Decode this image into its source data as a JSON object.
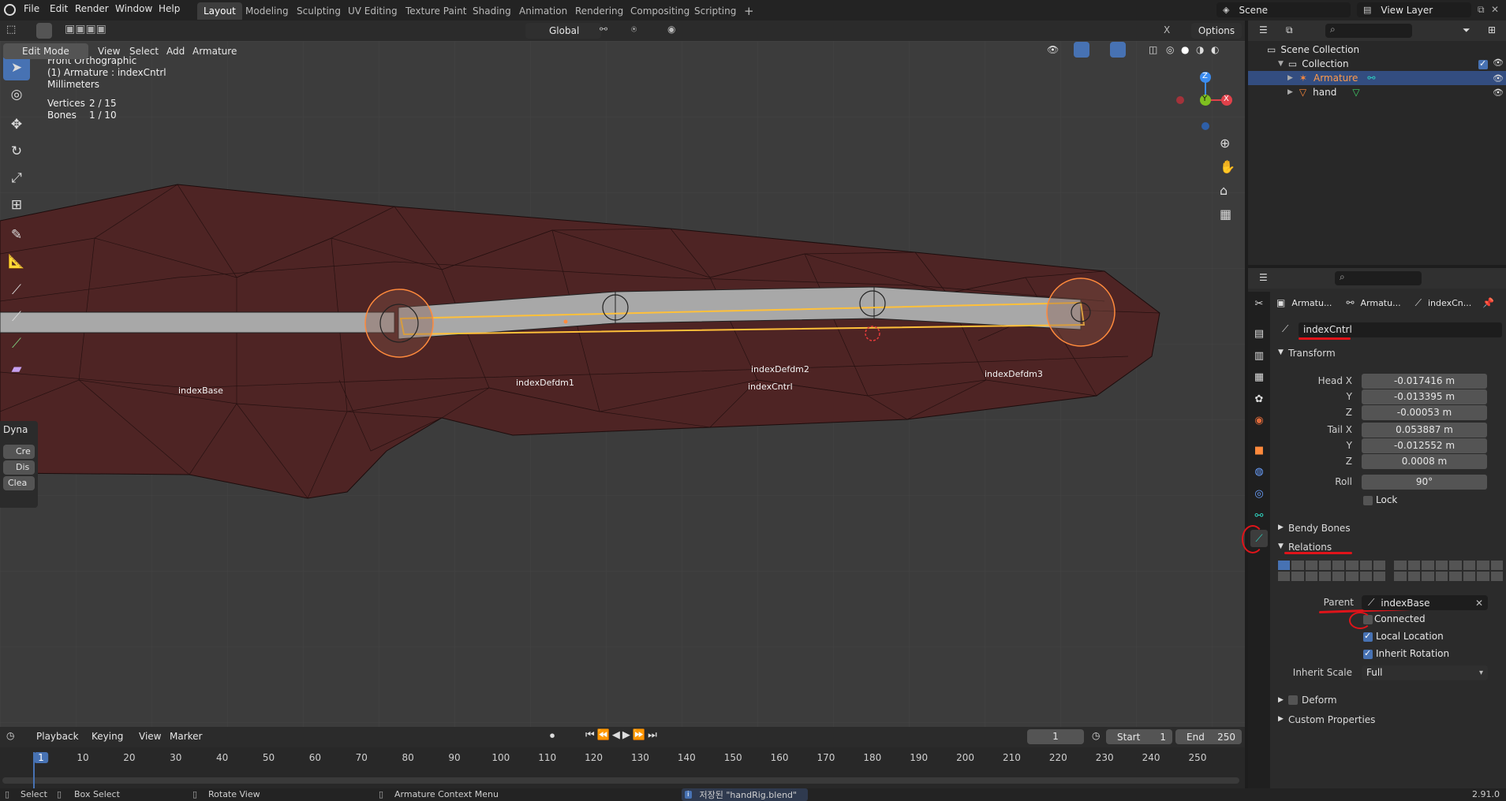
{
  "topbar": {
    "menus": [
      "File",
      "Edit",
      "Render",
      "Window",
      "Help"
    ],
    "workspaces": [
      "Layout",
      "Modeling",
      "Sculpting",
      "UV Editing",
      "Texture Paint",
      "Shading",
      "Animation",
      "Rendering",
      "Compositing",
      "Scripting"
    ],
    "active_workspace": "Layout",
    "add_tab": "+",
    "scene": "Scene",
    "view_layer": "View Layer"
  },
  "viewport_header": {
    "mode": "Edit Mode",
    "menus": [
      "View",
      "Select",
      "Add",
      "Armature"
    ],
    "transform_orientation": "Global",
    "options": "Options",
    "x_label": "X"
  },
  "overlay": {
    "view_name": "Front Orthographic",
    "object_line": "(1) Armature : indexCntrl",
    "units": "Millimeters",
    "vertices_label": "Vertices",
    "vertices_value": "2 / 15",
    "bones_label": "Bones",
    "bones_value": "1 / 10"
  },
  "bones": {
    "b1": "indexBase",
    "b2": "indexDefdm1",
    "b3": "indexDefdm2",
    "b4": "indexCntrl",
    "b5": "indexDefdm3"
  },
  "gizmo": {
    "z": "Z",
    "y": "Y",
    "x": "X"
  },
  "dyna_panel": {
    "title": "Dyna",
    "btn1": "Cre",
    "btn2": "Dis",
    "btn3": "Clea"
  },
  "outliner": {
    "scene_collection": "Scene Collection",
    "collection": "Collection",
    "armature": "Armature",
    "hand": "hand"
  },
  "props": {
    "breadcrumb": [
      "Armatu...",
      "Armatu...",
      "indexCn..."
    ],
    "bone_name": "indexCntrl",
    "transform": {
      "title": "Transform",
      "head_x_label": "Head X",
      "head_x": "-0.017416 m",
      "head_y_label": "Y",
      "head_y": "-0.013395 m",
      "head_z_label": "Z",
      "head_z": "-0.00053 m",
      "tail_x_label": "Tail X",
      "tail_x": "0.053887 m",
      "tail_y_label": "Y",
      "tail_y": "-0.012552 m",
      "tail_z_label": "Z",
      "tail_z": "0.0008 m",
      "roll_label": "Roll",
      "roll": "90°",
      "lock_label": "Lock"
    },
    "bendy_bones": "Bendy Bones",
    "relations": {
      "title": "Relations",
      "parent_label": "Parent",
      "parent_value": "indexBase",
      "connected_label": "Connected",
      "connected": false,
      "local_location_label": "Local Location",
      "local_location": true,
      "inherit_rotation_label": "Inherit Rotation",
      "inherit_rotation": true,
      "inherit_scale_label": "Inherit Scale",
      "inherit_scale_value": "Full"
    },
    "deform": "Deform",
    "custom_properties": "Custom Properties"
  },
  "timeline": {
    "menus": [
      "Playback",
      "Keying",
      "View",
      "Marker"
    ],
    "current_frame": "1",
    "start_label": "Start",
    "start": "1",
    "end_label": "End",
    "end": "250",
    "ticks": [
      "1",
      "10",
      "20",
      "30",
      "40",
      "50",
      "60",
      "70",
      "80",
      "90",
      "100",
      "110",
      "120",
      "130",
      "140",
      "150",
      "160",
      "170",
      "180",
      "190",
      "200",
      "210",
      "220",
      "230",
      "240",
      "250"
    ]
  },
  "statusbar": {
    "select": "Select",
    "box_select": "Box Select",
    "rotate_view": "Rotate View",
    "context_menu": "Armature Context Menu",
    "saved_message": "저장된 \"handRig.blend\"",
    "version": "2.91.0"
  },
  "colors": {
    "accent": "#4772b3",
    "mesh_fill": "#4e2424",
    "bone_fill": "#a6a6a6",
    "selected_outline": "#ffc03a",
    "annotation_red": "#e0141a",
    "armature_highlight": "#ff8a3c"
  }
}
